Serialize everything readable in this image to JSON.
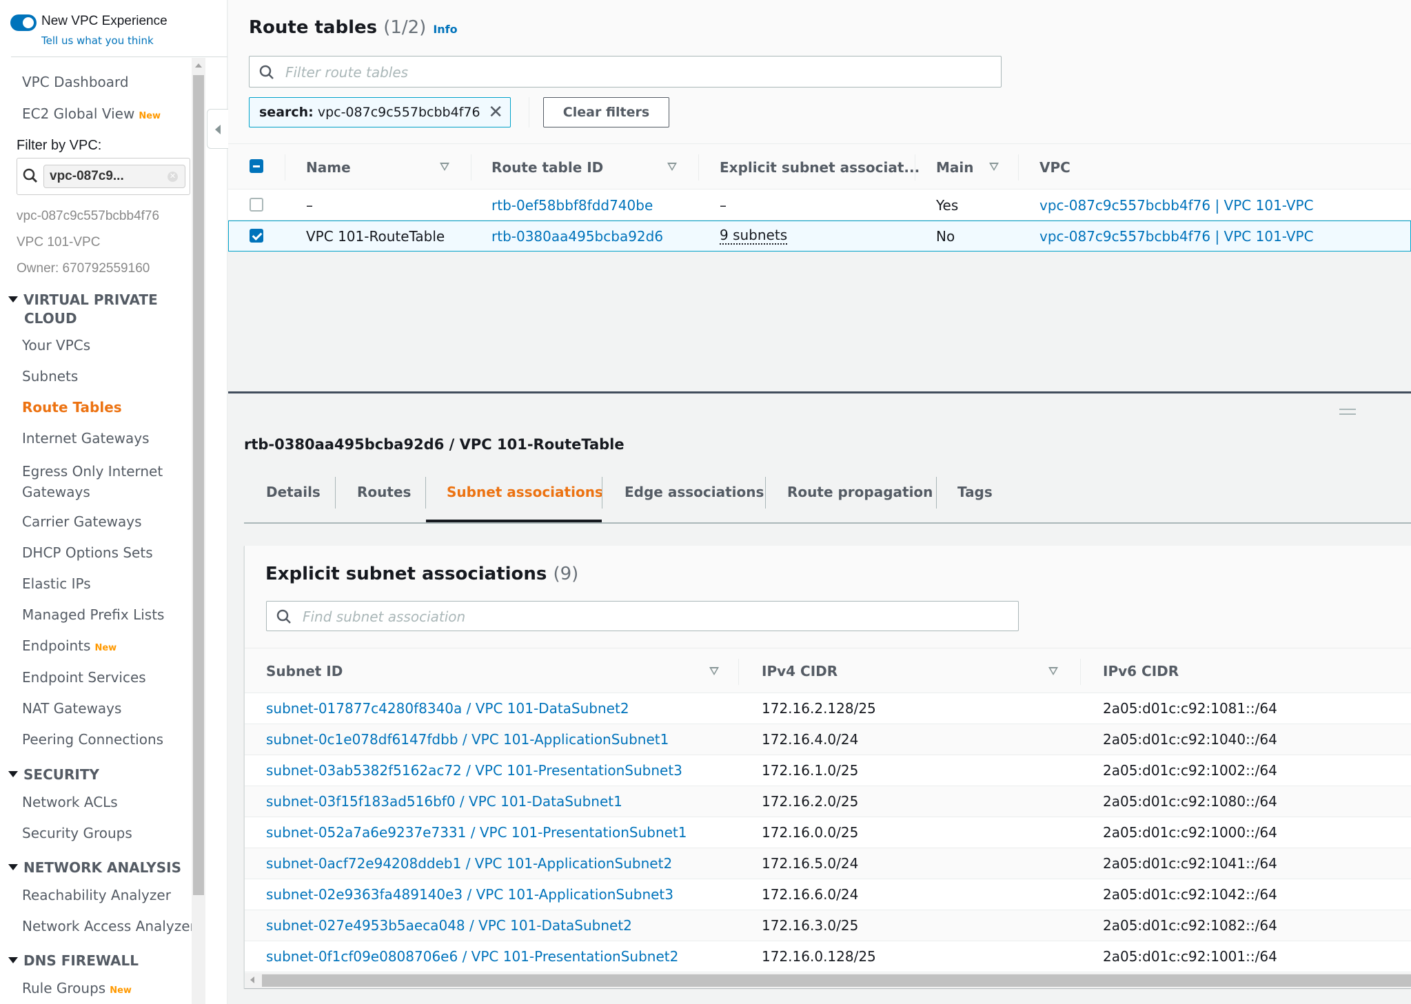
{
  "sidebar": {
    "experience_toggle_label": "New VPC Experience",
    "feedback_link": "Tell us what you think",
    "top_items": [
      {
        "label": "VPC Dashboard",
        "badge": ""
      },
      {
        "label": "EC2 Global View",
        "badge": "New"
      }
    ],
    "filter_label": "Filter by VPC:",
    "filter_value": "vpc-087c9...",
    "filter_info": [
      "vpc-087c9c557bcbb4f76",
      "VPC 101-VPC",
      "Owner: 670792559160"
    ],
    "sections": [
      {
        "title_line1": "VIRTUAL PRIVATE",
        "title_line2": "CLOUD",
        "items": [
          {
            "label": "Your VPCs",
            "badge": ""
          },
          {
            "label": "Subnets",
            "badge": ""
          },
          {
            "label": "Route Tables",
            "badge": "",
            "active": true
          },
          {
            "label": "Internet Gateways",
            "badge": ""
          },
          {
            "label": "Egress Only Internet",
            "label2": "Gateways",
            "badge": ""
          },
          {
            "label": "Carrier Gateways",
            "badge": ""
          },
          {
            "label": "DHCP Options Sets",
            "badge": ""
          },
          {
            "label": "Elastic IPs",
            "badge": ""
          },
          {
            "label": "Managed Prefix Lists",
            "badge": ""
          },
          {
            "label": "Endpoints",
            "badge": "New"
          },
          {
            "label": "Endpoint Services",
            "badge": ""
          },
          {
            "label": "NAT Gateways",
            "badge": ""
          },
          {
            "label": "Peering Connections",
            "badge": ""
          }
        ]
      },
      {
        "title_line1": "SECURITY",
        "items": [
          {
            "label": "Network ACLs"
          },
          {
            "label": "Security Groups"
          }
        ]
      },
      {
        "title_line1": "NETWORK ANALYSIS",
        "items": [
          {
            "label": "Reachability Analyzer"
          },
          {
            "label": "Network Access Analyzer"
          }
        ]
      },
      {
        "title_line1": "DNS FIREWALL",
        "items": [
          {
            "label": "Rule Groups",
            "badge": "New"
          }
        ]
      }
    ]
  },
  "route_tables": {
    "title": "Route tables",
    "count": "(1/2)",
    "info_link": "Info",
    "filter_placeholder": "Filter route tables",
    "token_key": "search:",
    "token_value": "vpc-087c9c557bcbb4f76",
    "clear_filters": "Clear filters",
    "columns": [
      "Name",
      "Route table ID",
      "Explicit subnet associat...",
      "Main",
      "VPC"
    ],
    "rows": [
      {
        "selected": false,
        "name": "–",
        "id": "rtb-0ef58bbf8fdd740be",
        "explicit": "–",
        "main": "Yes",
        "vpc": "vpc-087c9c557bcbb4f76 | VPC 101-VPC"
      },
      {
        "selected": true,
        "name": "VPC 101-RouteTable",
        "id": "rtb-0380aa495bcba92d6",
        "explicit": "9 subnets",
        "main": "No",
        "vpc": "vpc-087c9c557bcbb4f76 | VPC 101-VPC"
      }
    ]
  },
  "detail": {
    "title": "rtb-0380aa495bcba92d6 / VPC 101-RouteTable",
    "tabs": [
      "Details",
      "Routes",
      "Subnet associations",
      "Edge associations",
      "Route propagation",
      "Tags"
    ],
    "active_tab": "Subnet associations",
    "panel": {
      "title": "Explicit subnet associations",
      "count": "(9)",
      "search_placeholder": "Find subnet association",
      "columns": [
        "Subnet ID",
        "IPv4 CIDR",
        "IPv6 CIDR"
      ],
      "rows": [
        {
          "subnet": "subnet-017877c4280f8340a / VPC 101-DataSubnet2",
          "ipv4": "172.16.2.128/25",
          "ipv6": "2a05:d01c:c92:1081::/64"
        },
        {
          "subnet": "subnet-0c1e078df6147fdbb / VPC 101-ApplicationSubnet1",
          "ipv4": "172.16.4.0/24",
          "ipv6": "2a05:d01c:c92:1040::/64"
        },
        {
          "subnet": "subnet-03ab5382f5162ac72 / VPC 101-PresentationSubnet3",
          "ipv4": "172.16.1.0/25",
          "ipv6": "2a05:d01c:c92:1002::/64"
        },
        {
          "subnet": "subnet-03f15f183ad516bf0 / VPC 101-DataSubnet1",
          "ipv4": "172.16.2.0/25",
          "ipv6": "2a05:d01c:c92:1080::/64"
        },
        {
          "subnet": "subnet-052a7a6e9237e7331 / VPC 101-PresentationSubnet1",
          "ipv4": "172.16.0.0/25",
          "ipv6": "2a05:d01c:c92:1000::/64"
        },
        {
          "subnet": "subnet-0acf72e94208ddeb1 / VPC 101-ApplicationSubnet2",
          "ipv4": "172.16.5.0/24",
          "ipv6": "2a05:d01c:c92:1041::/64"
        },
        {
          "subnet": "subnet-02e9363fa489140e3 / VPC 101-ApplicationSubnet3",
          "ipv4": "172.16.6.0/24",
          "ipv6": "2a05:d01c:c92:1042::/64"
        },
        {
          "subnet": "subnet-027e4953b5aeca048 / VPC 101-DataSubnet2",
          "ipv4": "172.16.3.0/25",
          "ipv6": "2a05:d01c:c92:1082::/64"
        },
        {
          "subnet": "subnet-0f1cf09e0808706e6 / VPC 101-PresentationSubnet2",
          "ipv4": "172.16.0.128/25",
          "ipv6": "2a05:d01c:c92:1001::/64"
        }
      ]
    }
  },
  "colors": {
    "link": "#0073bb",
    "accent_orange": "#ec7211",
    "new_badge": "#ff9900",
    "selection_border": "#00a1c9",
    "selection_bg": "#f1faff"
  }
}
